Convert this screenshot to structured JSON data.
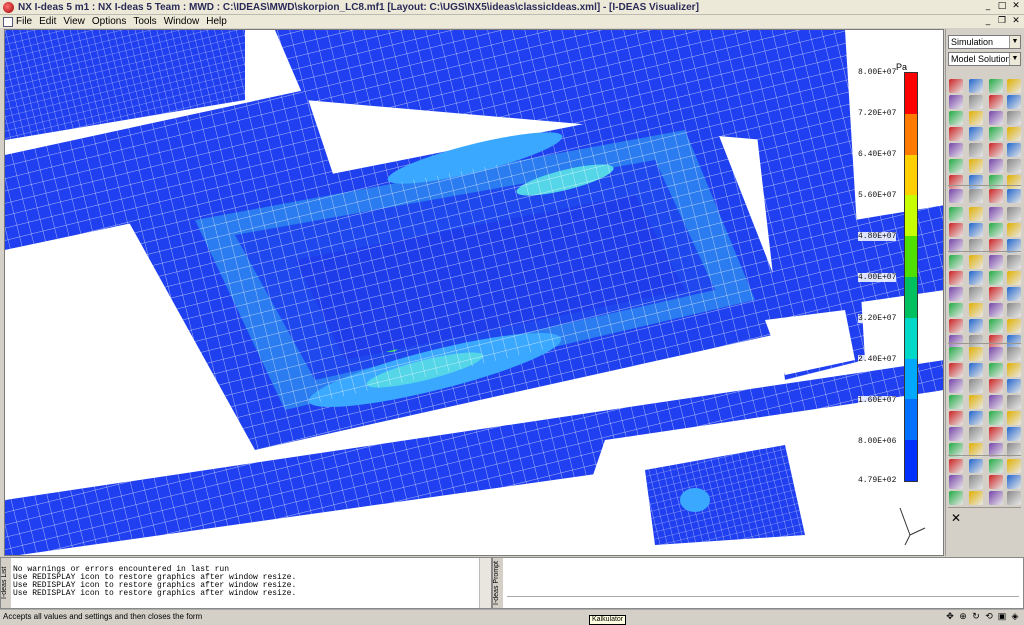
{
  "window": {
    "title": "NX I-deas 5 m1 : NX I-deas 5 Team : MWD : C:\\IDEAS\\MWD\\skorpion_LC8.mf1 [Layout: C:\\UGS\\NX5\\ideas\\classicIdeas.xml] - [I-DEAS Visualizer]",
    "minimize": "_",
    "maximize": "□",
    "close": "✕",
    "inner_minimize": "_",
    "inner_restore": "❐",
    "inner_close": "✕"
  },
  "menu": {
    "items": [
      "File",
      "Edit",
      "View",
      "Options",
      "Tools",
      "Window",
      "Help"
    ]
  },
  "legend": {
    "unit": "Pa",
    "colors": [
      "#ff0000",
      "#ff7a00",
      "#ffd000",
      "#c8ff00",
      "#50e000",
      "#00c060",
      "#00d8c8",
      "#00a8ff",
      "#0070ff",
      "#0030ff"
    ],
    "labels": [
      "8.00E+07",
      "7.20E+07",
      "6.40E+07",
      "5.60E+07",
      "4.80E+07",
      "4.00E+07",
      "3.20E+07",
      "2.40E+07",
      "1.60E+07",
      "8.00E+06",
      "4.79E+02"
    ]
  },
  "rightpanel": {
    "task": "Simulation",
    "subtask": "Model Solution",
    "icon_colors": [
      "#cc2222",
      "#2266cc",
      "#22aa44",
      "#e0b000",
      "#7744aa",
      "#888888"
    ]
  },
  "list": {
    "label": "I-deas List",
    "lines": [
      "No warnings or errors encountered in last run",
      "Use REDISPLAY icon to restore graphics after window resize.",
      "Use REDISPLAY icon to restore graphics after window resize.",
      "Use REDISPLAY icon to restore graphics after window resize."
    ]
  },
  "prompt": {
    "label": "I-deas Prompt"
  },
  "status": {
    "message": "Accepts all values and settings and then closes the form",
    "tooltip": "Kalkulator"
  }
}
